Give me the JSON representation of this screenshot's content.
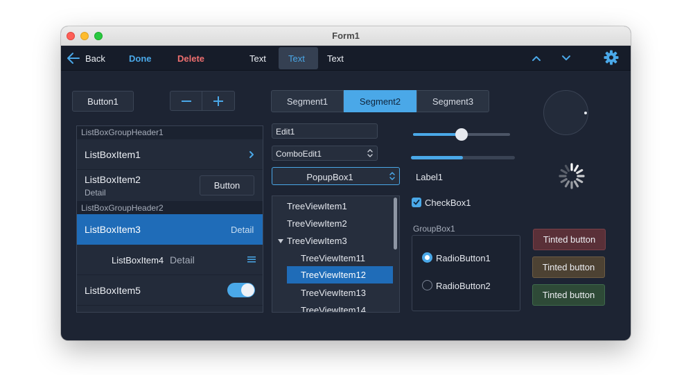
{
  "window": {
    "title": "Form1"
  },
  "toolbar": {
    "back_label": "Back",
    "done_label": "Done",
    "delete_label": "Delete",
    "tabs": [
      "Text",
      "Text",
      "Text"
    ]
  },
  "button1": {
    "label": "Button1"
  },
  "segments": [
    "Segment1",
    "Segment2",
    "Segment3"
  ],
  "listbox": {
    "group1": "ListBoxGroupHeader1",
    "group2": "ListBoxGroupHeader2",
    "item1": {
      "title": "ListBoxItem1"
    },
    "item2": {
      "title": "ListBoxItem2",
      "detail": "Detail",
      "button": "Button"
    },
    "item3": {
      "title": "ListBoxItem3",
      "detail": "Detail"
    },
    "item4": {
      "title": "ListBoxItem4",
      "detail": "Detail"
    },
    "item5": {
      "title": "ListBoxItem5",
      "switch_on": true
    }
  },
  "edit1": {
    "value": "Edit1"
  },
  "comboedit1": {
    "value": "ComboEdit1"
  },
  "popupbox1": {
    "value": "PopupBox1"
  },
  "treeview": {
    "items": [
      "TreeViewItem1",
      "TreeViewItem2",
      "TreeViewItem3",
      "TreeViewItem11",
      "TreeViewItem12",
      "TreeViewItem13",
      "TreeViewItem14"
    ],
    "selected": "TreeViewItem12"
  },
  "trackbar": {
    "value": 0.5
  },
  "progress": {
    "value": 0.5
  },
  "label1": {
    "text": "Label1"
  },
  "checkbox1": {
    "label": "CheckBox1",
    "checked": true
  },
  "groupbox1": {
    "title": "GroupBox1",
    "radio1": {
      "label": "RadioButton1",
      "checked": true
    },
    "radio2": {
      "label": "RadioButton2",
      "checked": false
    }
  },
  "tinted_buttons": [
    "Tinted button",
    "Tinted button",
    "Tinted button"
  ],
  "colors": {
    "accent": "#4aa8e8",
    "selected": "#1f6cb8",
    "delete": "#ee6f6f",
    "tint_red": "#5a3038",
    "tint_brown": "#4d4233",
    "tint_green": "#2e4a37"
  },
  "icons": [
    "back-arrow-icon",
    "chevron-up-icon",
    "chevron-down-icon",
    "gear-icon",
    "minus-icon",
    "plus-icon",
    "chevron-right-icon",
    "hamburger-icon",
    "updown-icon",
    "expand-triangle-icon",
    "check-icon",
    "spinner-icon"
  ]
}
